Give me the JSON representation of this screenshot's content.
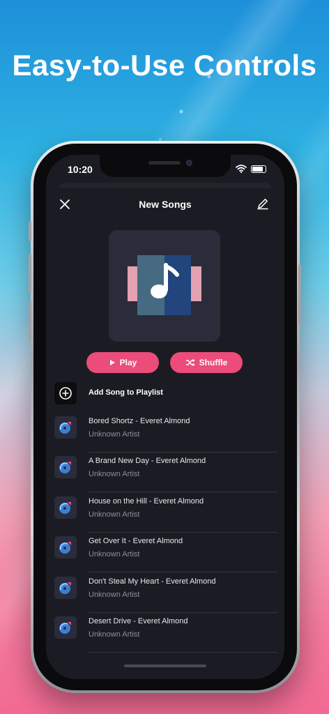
{
  "headline": "Easy-to-Use Controls",
  "status_bar": {
    "time": "10:20"
  },
  "nav": {
    "title": "New Songs"
  },
  "actions": {
    "play_label": "Play",
    "shuffle_label": "Shuffle"
  },
  "add_song": {
    "label": "Add Song to Playlist"
  },
  "songs": [
    {
      "title": "Bored Shortz - Everet Almond",
      "artist": "Unknown Artist"
    },
    {
      "title": "A Brand New Day - Everet Almond",
      "artist": "Unknown Artist"
    },
    {
      "title": "House on the Hill - Everet Almond",
      "artist": "Unknown Artist"
    },
    {
      "title": "Get Over It - Everet Almond",
      "artist": "Unknown Artist"
    },
    {
      "title": "Don't Steal My Heart - Everet Almond",
      "artist": "Unknown Artist"
    },
    {
      "title": "Desert Drive - Everet Almond",
      "artist": "Unknown Artist"
    }
  ],
  "colors": {
    "accent": "#ec4c7a",
    "panel": "#1b1c23",
    "art_bg": "#2b2c3a"
  },
  "icons": [
    "close-icon",
    "edit-icon",
    "music-note-icon",
    "play-icon",
    "shuffle-icon",
    "add-circle-icon",
    "wifi-icon",
    "battery-icon",
    "record-icon"
  ]
}
